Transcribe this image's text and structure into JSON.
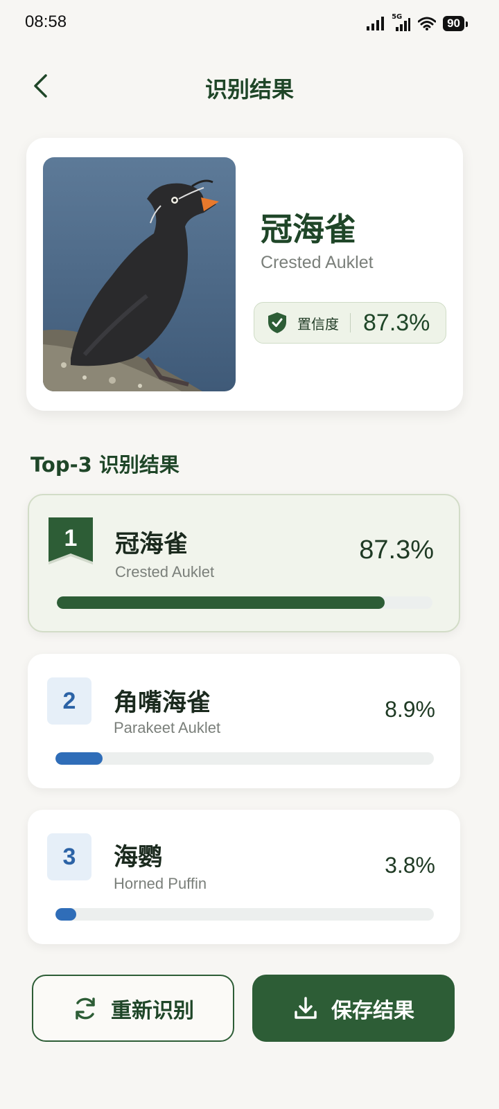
{
  "status_bar": {
    "time": "08:58",
    "network": "5G",
    "battery": "90"
  },
  "header": {
    "title": "识别结果"
  },
  "hero": {
    "name": "冠海雀",
    "latin": "Crested Auklet",
    "confidence_label": "置信度",
    "confidence_value": "87.3%"
  },
  "section": {
    "title": "Top-3 识别结果"
  },
  "results": [
    {
      "rank": "1",
      "name": "冠海雀",
      "latin": "Crested Auklet",
      "value": "87.3%",
      "fraction": 0.873
    },
    {
      "rank": "2",
      "name": "角嘴海雀",
      "latin": "Parakeet Auklet",
      "value": "8.9%",
      "fraction": 0.125
    },
    {
      "rank": "3",
      "name": "海鹦",
      "latin": "Horned Puffin",
      "value": "3.8%",
      "fraction": 0.055
    }
  ],
  "buttons": {
    "retry": "重新识别",
    "save": "保存结果"
  },
  "colors": {
    "primary": "#2d5d36",
    "secondary_bar": "#2f6db8",
    "card_highlight": "#f1f4ec"
  }
}
